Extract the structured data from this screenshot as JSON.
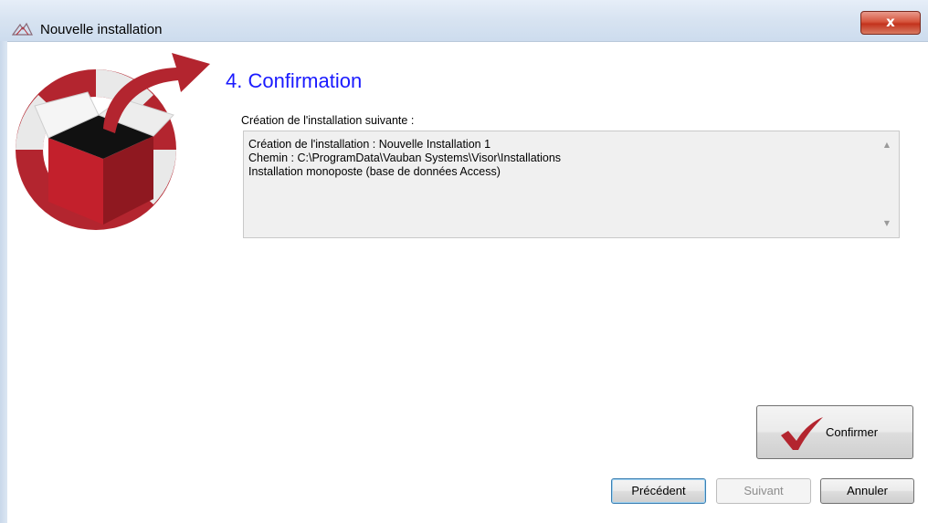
{
  "window": {
    "title": "Nouvelle installation",
    "close_label": "x"
  },
  "step": {
    "heading": "4. Confirmation",
    "summary_label": "Création de l'installation suivante :",
    "summary_lines": [
      "Création de l'installation : Nouvelle Installation 1",
      "Chemin : C:\\ProgramData\\Vauban Systems\\Visor\\Installations",
      "Installation monoposte (base de données Access)"
    ]
  },
  "actions": {
    "confirm_label": "Confirmer",
    "previous_label": "Précédent",
    "next_label": "Suivant",
    "cancel_label": "Annuler"
  },
  "colors": {
    "heading": "#1a1aff",
    "brand_red": "#b3252f",
    "close_red": "#c3331d"
  }
}
